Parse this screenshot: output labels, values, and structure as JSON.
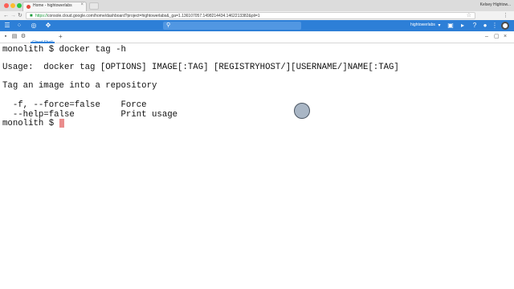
{
  "browser": {
    "tab_title": "Home - hightowerlabs",
    "profile_name": "Kelsey Hightow...",
    "url_scheme": "https://",
    "url_rest": "console.cloud.google.com/home/dashboard?project=hightowerlabs&_ga=1.136107057.1498214434.1462213382&pli=1"
  },
  "console": {
    "project_name": "hightowerlabs",
    "brand_color": "#2d7fd7"
  },
  "shell": {
    "tab_label": "Cloud Shell",
    "add_tab_label": "+"
  },
  "terminal": {
    "lines": [
      "monolith $ docker tag -h",
      "Usage:  docker tag [OPTIONS] IMAGE[:TAG] [REGISTRYHOST/][USERNAME/]NAME[:TAG]",
      "Tag an image into a repository",
      "  -f, --force=false    Force",
      "  --help=false         Print usage",
      "monolith $ "
    ],
    "cursor_color": "#ea8c8c"
  },
  "icons": {
    "nav": [
      "back-icon",
      "forward-icon",
      "reload-icon"
    ],
    "header": [
      "menu-icon",
      "gift-icon",
      "support-icon",
      "notifications-icon",
      "more-icon"
    ]
  }
}
